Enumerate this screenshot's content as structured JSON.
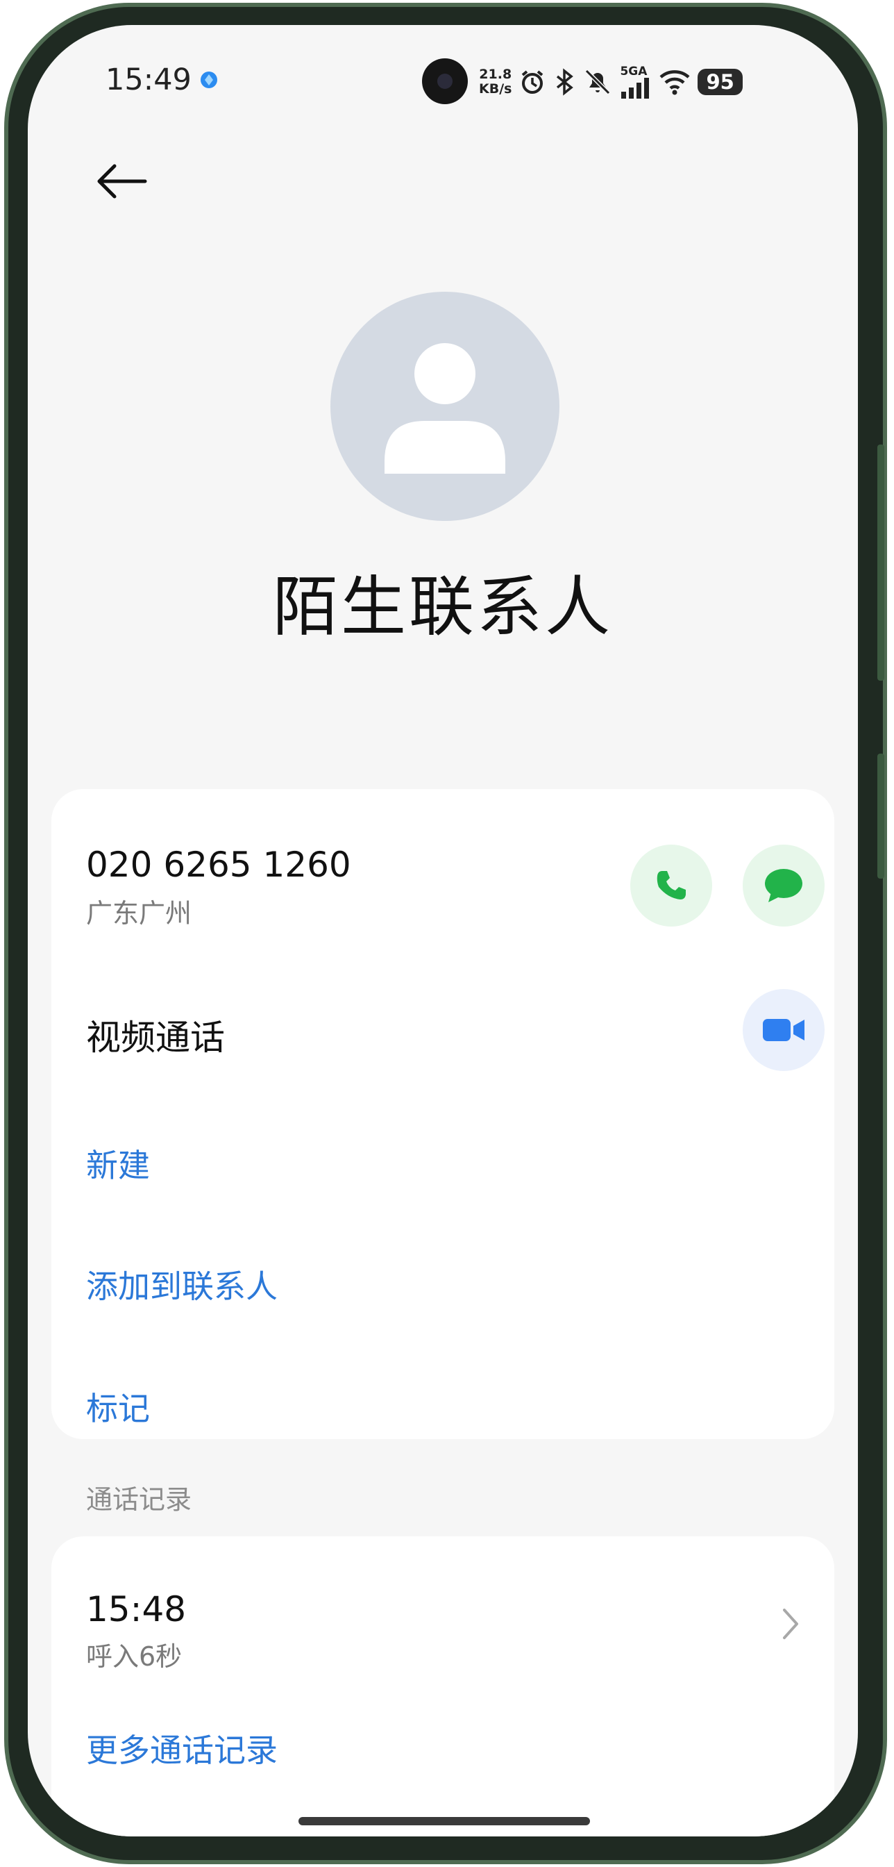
{
  "status_bar": {
    "time": "15:49",
    "net_speed_value": "21.8",
    "net_speed_unit": "KB/s",
    "network_label": "5GA",
    "battery": "95",
    "icons": [
      "alarm-icon",
      "bluetooth-icon",
      "mute-icon",
      "signal-icon",
      "wifi-icon",
      "battery-icon"
    ]
  },
  "contact": {
    "name": "陌生联系人"
  },
  "phone": {
    "number": "020 6265 1260",
    "location": "广东广州"
  },
  "actions": {
    "video_call": "视频通话",
    "new": "新建",
    "add_to_contacts": "添加到联系人",
    "mark": "标记"
  },
  "call_log": {
    "section_title": "通话记录",
    "entries": [
      {
        "time": "15:48",
        "detail": "呼入6秒"
      }
    ],
    "more_label": "更多通话记录"
  },
  "colors": {
    "accent_blue": "#2b78d8",
    "call_green": "#22b34a",
    "video_blue": "#2f7ff0"
  }
}
